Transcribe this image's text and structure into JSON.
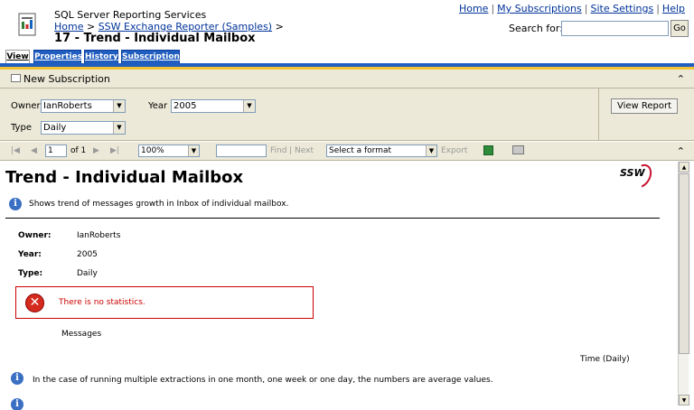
{
  "header": {
    "service_name": "SQL Server Reporting Services",
    "breadcrumb": {
      "home": "Home",
      "separator": ">",
      "folder": "SSW Exchange Reporter (Samples)"
    },
    "report_title": "17 - Trend - Individual Mailbox",
    "top_links": [
      "Home",
      "My Subscriptions",
      "Site Settings",
      "Help"
    ],
    "search_label": "Search for:",
    "search_value": "",
    "go_label": "Go"
  },
  "tabs": [
    {
      "label": "View",
      "active": true
    },
    {
      "label": "Properties",
      "active": false
    },
    {
      "label": "History",
      "active": false
    },
    {
      "label": "Subscriptions",
      "active": false
    }
  ],
  "subscription_bar": {
    "label": "New Subscription"
  },
  "parameters": {
    "owner_label": "Owner",
    "owner_value": "IanRoberts",
    "year_label": "Year",
    "year_value": "2005",
    "type_label": "Type",
    "type_value": "Daily",
    "view_report_label": "View Report"
  },
  "toolbar": {
    "page_value": "1",
    "of_label": "of 1",
    "zoom_value": "100%",
    "find_value": "",
    "find_label": "Find",
    "next_label": "Next",
    "format_value": "Select a format",
    "export_label": "Export"
  },
  "report": {
    "title": "Trend - Individual Mailbox",
    "logo_text": "SSW",
    "description": "Shows trend of messages growth in Inbox of individual mailbox.",
    "fields": [
      {
        "label": "Owner:",
        "value": "IanRoberts"
      },
      {
        "label": "Year:",
        "value": "2005"
      },
      {
        "label": "Type:",
        "value": "Daily"
      }
    ],
    "error_message": "There is no statistics.",
    "y_axis_label": "Messages",
    "x_axis_label": "Time (Daily)",
    "note": "In the case of running multiple extractions in one month, one week or one day, the numbers are average values."
  },
  "colors": {
    "tab_blue": "#1f5dbf",
    "toolbar_bg": "#ece9d8",
    "error_red": "#cc0000"
  },
  "icons": [
    "report-app-icon",
    "envelope-icon",
    "collapse-chevron-icon",
    "first-page-icon",
    "prev-page-icon",
    "next-page-icon",
    "last-page-icon",
    "refresh-icon",
    "print-icon",
    "info-icon",
    "error-icon",
    "ssw-logo"
  ]
}
